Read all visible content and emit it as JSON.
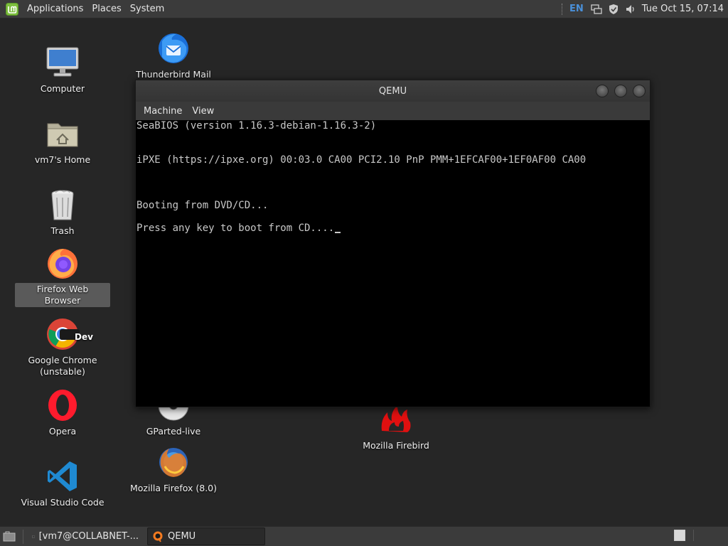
{
  "top_panel": {
    "menus": [
      "Applications",
      "Places",
      "System"
    ],
    "language": "EN",
    "clock": "Tue Oct 15, 07:14"
  },
  "desktop": {
    "icons": [
      {
        "name": "Computer",
        "icon": "computer-icon"
      },
      {
        "name": "vm7's Home",
        "icon": "home-folder-icon"
      },
      {
        "name": "Trash",
        "icon": "trash-icon"
      },
      {
        "name": "Firefox Web Browser",
        "icon": "firefox-icon"
      },
      {
        "name": "Google Chrome (unstable)",
        "icon": "chrome-dev-icon"
      },
      {
        "name": "Opera",
        "icon": "opera-icon"
      },
      {
        "name": "Visual Studio Code",
        "icon": "vscode-icon"
      },
      {
        "name": "Thunderbird Mail",
        "icon": "thunderbird-icon"
      },
      {
        "name": "GParted-live",
        "icon": "disc-icon"
      },
      {
        "name": "Mozilla Firefox (8.0)",
        "icon": "firefox-old-icon"
      },
      {
        "name": "Mozilla Firebird",
        "icon": "firebird-icon"
      }
    ]
  },
  "qemu": {
    "title": "QEMU",
    "menu": [
      "Machine",
      "View"
    ],
    "console_lines": [
      "SeaBIOS (version 1.16.3-debian-1.16.3-2)",
      "iPXE (https://ipxe.org) 00:03.0 CA00 PCI2.10 PnP PMM+1EFCAF00+1EF0AF00 CA00",
      "Booting from DVD/CD...",
      "Press any key to boot from CD...."
    ]
  },
  "taskbar": {
    "tasks": [
      {
        "label": "[vm7@COLLABNET-...",
        "icon": "terminal-icon"
      },
      {
        "label": "QEMU",
        "icon": "qemu-icon"
      }
    ]
  },
  "colors": {
    "panel": "#3b3b3b",
    "desktop": "#262626",
    "accent": "#4a90d9"
  }
}
